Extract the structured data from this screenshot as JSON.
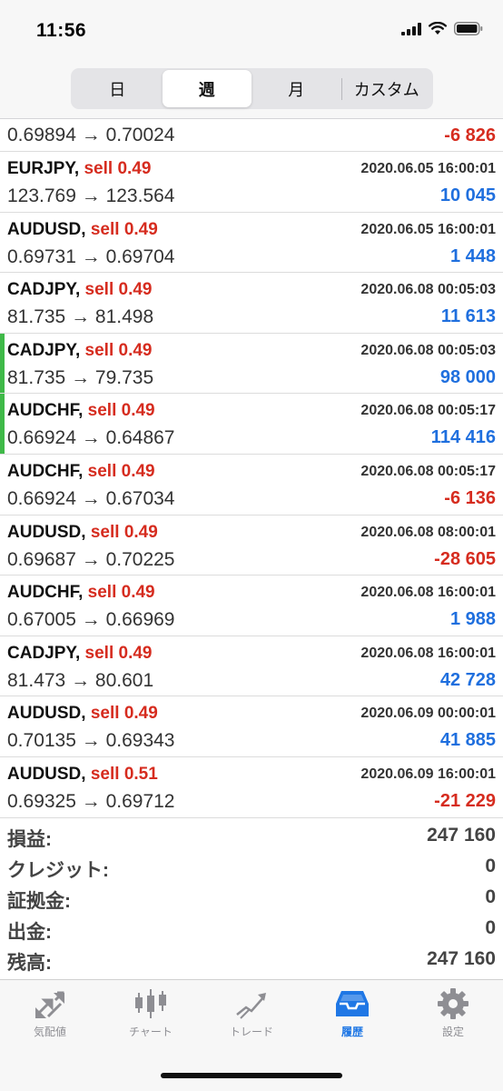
{
  "status": {
    "time": "11:56"
  },
  "segments": [
    {
      "label": "日",
      "active": false
    },
    {
      "label": "週",
      "active": true
    },
    {
      "label": "月",
      "active": false
    },
    {
      "label": "カスタム",
      "active": false
    }
  ],
  "trades": [
    {
      "symbol": "",
      "side": "",
      "date": "",
      "prices": "0.69894 → 0.70024",
      "pnl": "-6 826",
      "negative": true,
      "partial": true,
      "accent": false
    },
    {
      "symbol": "EURJPY,",
      "side": "sell 0.49",
      "date": "2020.06.05 16:00:01",
      "prices": "123.769 → 123.564",
      "pnl": "10 045",
      "negative": false,
      "partial": false,
      "accent": false
    },
    {
      "symbol": "AUDUSD,",
      "side": "sell 0.49",
      "date": "2020.06.05 16:00:01",
      "prices": "0.69731 → 0.69704",
      "pnl": "1 448",
      "negative": false,
      "partial": false,
      "accent": false
    },
    {
      "symbol": "CADJPY,",
      "side": "sell 0.49",
      "date": "2020.06.08 00:05:03",
      "prices": "81.735 → 81.498",
      "pnl": "11 613",
      "negative": false,
      "partial": false,
      "accent": false
    },
    {
      "symbol": "CADJPY,",
      "side": "sell 0.49",
      "date": "2020.06.08 00:05:03",
      "prices": "81.735 → 79.735",
      "pnl": "98 000",
      "negative": false,
      "partial": false,
      "accent": true
    },
    {
      "symbol": "AUDCHF,",
      "side": "sell 0.49",
      "date": "2020.06.08 00:05:17",
      "prices": "0.66924 → 0.64867",
      "pnl": "114 416",
      "negative": false,
      "partial": false,
      "accent": true
    },
    {
      "symbol": "AUDCHF,",
      "side": "sell 0.49",
      "date": "2020.06.08 00:05:17",
      "prices": "0.66924 → 0.67034",
      "pnl": "-6 136",
      "negative": true,
      "partial": false,
      "accent": false
    },
    {
      "symbol": "AUDUSD,",
      "side": "sell 0.49",
      "date": "2020.06.08 08:00:01",
      "prices": "0.69687 → 0.70225",
      "pnl": "-28 605",
      "negative": true,
      "partial": false,
      "accent": false
    },
    {
      "symbol": "AUDCHF,",
      "side": "sell 0.49",
      "date": "2020.06.08 16:00:01",
      "prices": "0.67005 → 0.66969",
      "pnl": "1 988",
      "negative": false,
      "partial": false,
      "accent": false
    },
    {
      "symbol": "CADJPY,",
      "side": "sell 0.49",
      "date": "2020.06.08 16:00:01",
      "prices": "81.473 → 80.601",
      "pnl": "42 728",
      "negative": false,
      "partial": false,
      "accent": false
    },
    {
      "symbol": "AUDUSD,",
      "side": "sell 0.49",
      "date": "2020.06.09 00:00:01",
      "prices": "0.70135 → 0.69343",
      "pnl": "41 885",
      "negative": false,
      "partial": false,
      "accent": false
    },
    {
      "symbol": "AUDUSD,",
      "side": "sell 0.51",
      "date": "2020.06.09 16:00:01",
      "prices": "0.69325 → 0.69712",
      "pnl": "-21 229",
      "negative": true,
      "partial": false,
      "accent": false
    }
  ],
  "summary": [
    {
      "label": "損益:",
      "value": "247 160"
    },
    {
      "label": "クレジット:",
      "value": "0"
    },
    {
      "label": "証拠金:",
      "value": "0"
    },
    {
      "label": "出金:",
      "value": "0"
    },
    {
      "label": "残高:",
      "value": "247 160"
    }
  ],
  "tabs": [
    {
      "label": "気配値",
      "icon": "quotes-arrows-icon",
      "active": false
    },
    {
      "label": "チャート",
      "icon": "candlestick-chart-icon",
      "active": false
    },
    {
      "label": "トレード",
      "icon": "trade-line-icon",
      "active": false
    },
    {
      "label": "履歴",
      "icon": "history-inbox-icon",
      "active": true
    },
    {
      "label": "設定",
      "icon": "gear-icon",
      "active": false
    }
  ],
  "colors": {
    "sell_red": "#d62c1f",
    "profit_blue": "#1f6fde",
    "loss_red": "#d62c1f",
    "accent_green": "#3fb948",
    "tab_active": "#1f77e5",
    "tab_inactive": "#8e8e93"
  }
}
